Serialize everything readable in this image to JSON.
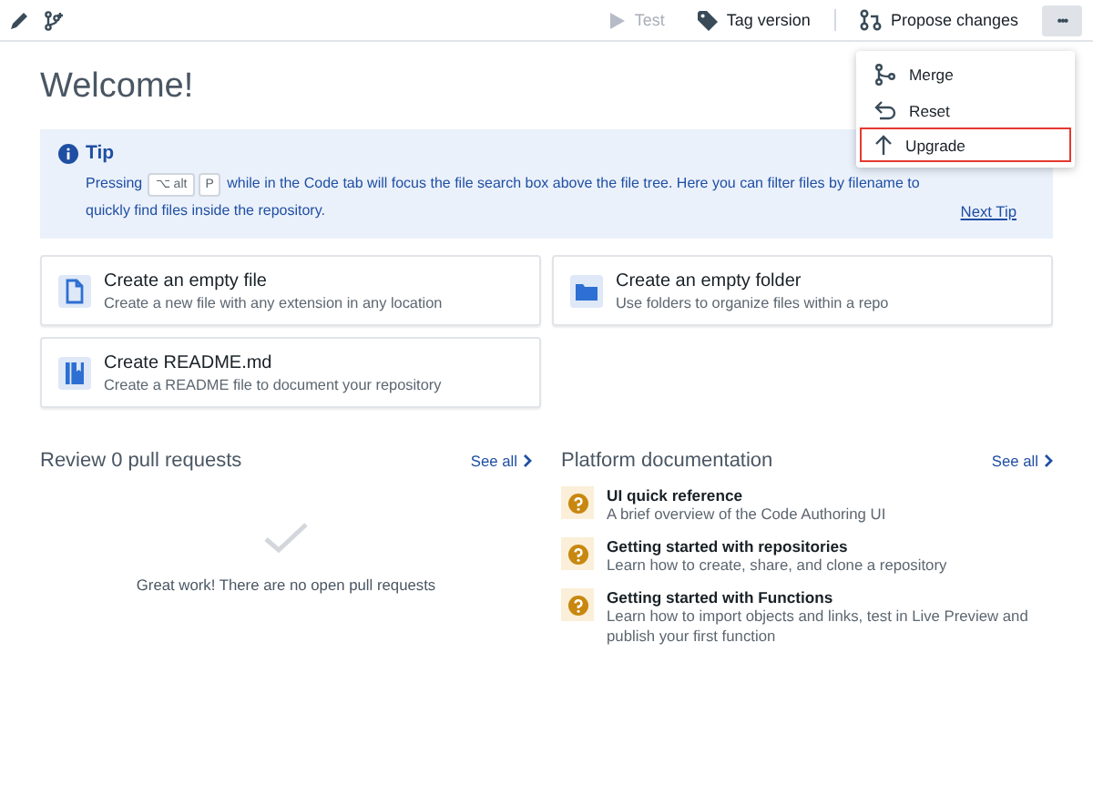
{
  "toolbar": {
    "buttons": [
      {
        "kind": "test",
        "label": "Test",
        "disabled": true
      },
      {
        "kind": "tag",
        "label": "Tag version",
        "disabled": false
      },
      {
        "kind": "propose",
        "label": "Propose changes",
        "disabled": false
      }
    ],
    "more": {
      "label": "•••",
      "expanded": true
    }
  },
  "menu": {
    "items": [
      {
        "kind": "merge",
        "label": "Merge",
        "selected": false
      },
      {
        "kind": "reset",
        "label": "Reset",
        "selected": false
      },
      {
        "kind": "upgrade",
        "label": "Upgrade",
        "selected": true
      }
    ]
  },
  "title": "Welcome!",
  "tip": {
    "title": "Tip",
    "before": "Pressing",
    "keys": [
      "⌥ alt",
      "P"
    ],
    "after": "while in the Code tab will focus the file search box above the file tree. Here you can filter files by filename to quickly find files inside the repository.",
    "link": "Next Tip"
  },
  "cards": [
    {
      "kind": "file",
      "title": "Create an empty file",
      "subtitle": "Create a new file with any extension in any location"
    },
    {
      "kind": "folder",
      "title": "Create an empty folder",
      "subtitle": "Use folders to organize files within a repo"
    },
    {
      "kind": "readme",
      "title": "Create README.md",
      "subtitle": "Create a README file to document your repository"
    }
  ],
  "pull_requests": {
    "title": "Review 0 pull requests",
    "see_all": "See all",
    "empty": "Great work! There are no open pull requests"
  },
  "documentation": {
    "title": "Platform documentation",
    "see_all": "See all",
    "items": [
      {
        "title": "UI quick reference",
        "subtitle": "A brief overview of the Code Authoring UI"
      },
      {
        "title": "Getting started with repositories",
        "subtitle": "Learn how to create, share, and clone a repository"
      },
      {
        "title": "Getting started with Functions",
        "subtitle": "Learn how to import objects and links, test in Live Preview and publish your first function"
      }
    ]
  }
}
